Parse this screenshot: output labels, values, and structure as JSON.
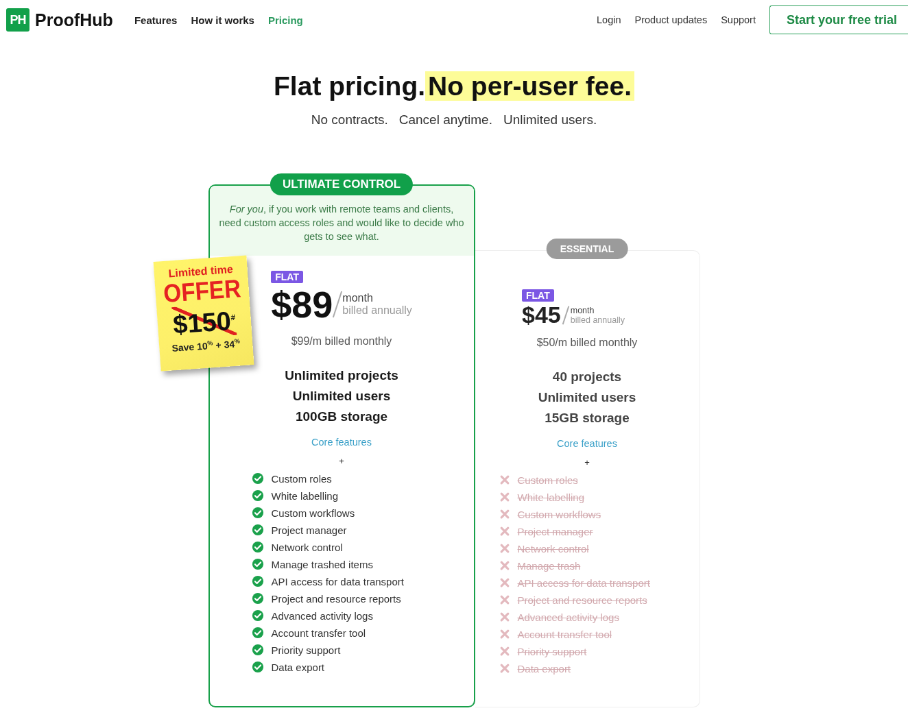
{
  "header": {
    "logo_mark": "PH",
    "logo_text": "ProofHub",
    "nav": [
      {
        "label": "Features",
        "selected": false
      },
      {
        "label": "How it works",
        "selected": false
      },
      {
        "label": "Pricing",
        "selected": true
      }
    ],
    "links": [
      "Login",
      "Product updates",
      "Support"
    ],
    "cta": "Start your free trial"
  },
  "hero": {
    "title": "Flat pricing.",
    "highlight": "No per-user fee.",
    "subtitle": [
      "No contracts.",
      "Cancel anytime.",
      "Unlimited users."
    ]
  },
  "offer": {
    "line_1": "Limited time",
    "line_2": "OFFER",
    "old_price": "$150$^{#}$",
    "save": "Save 10$^{%}$ + 34$^{%}$"
  },
  "plans": [
    {
      "name": "ULTIMATE CONTROL",
      "featured": true,
      "description": "*For you*, if you work with remote teams and clients, need custom access roles and would like to decide who gets to see what.",
      "tag": "FLAT",
      "price": "$89",
      "period": "month",
      "billing": "billed annually",
      "monthly": "$99/m billed monthly",
      "highlights": [
        "Unlimited projects",
        "Unlimited users",
        "100GB storage"
      ],
      "core_link": "Core features",
      "plus": "+",
      "features": [
        {
          "label": "Custom roles",
          "included": true
        },
        {
          "label": "White labelling",
          "included": true
        },
        {
          "label": "Custom workflows",
          "included": true
        },
        {
          "label": "Project manager",
          "included": true
        },
        {
          "label": "Network control",
          "included": true
        },
        {
          "label": "Manage trashed items",
          "included": true
        },
        {
          "label": "API access for data transport",
          "included": true
        },
        {
          "label": "Project and resource reports",
          "included": true
        },
        {
          "label": "Advanced activity logs",
          "included": true
        },
        {
          "label": "Account transfer tool",
          "included": true
        },
        {
          "label": "Priority support",
          "included": true
        },
        {
          "label": "Data export",
          "included": true
        }
      ]
    },
    {
      "name": "ESSENTIAL",
      "featured": false,
      "tag": "FLAT",
      "price": "$45",
      "period": "month",
      "billing": "billed annually",
      "monthly": "$50/m billed monthly",
      "highlights": [
        "40 projects",
        "Unlimited users",
        "15GB storage"
      ],
      "core_link": "Core features",
      "plus": "+",
      "features": [
        {
          "label": "Custom roles",
          "included": false
        },
        {
          "label": "White labelling",
          "included": false
        },
        {
          "label": "Custom workflows",
          "included": false
        },
        {
          "label": "Project manager",
          "included": false
        },
        {
          "label": "Network control",
          "included": false
        },
        {
          "label": "Manage trash",
          "included": false
        },
        {
          "label": "API access for data transport",
          "included": false
        },
        {
          "label": "Project and resource reports",
          "included": false
        },
        {
          "label": "Advanced activity logs",
          "included": false
        },
        {
          "label": "Account transfer tool",
          "included": false
        },
        {
          "label": "Priority support",
          "included": false
        },
        {
          "label": "Data export",
          "included": false
        }
      ]
    }
  ]
}
